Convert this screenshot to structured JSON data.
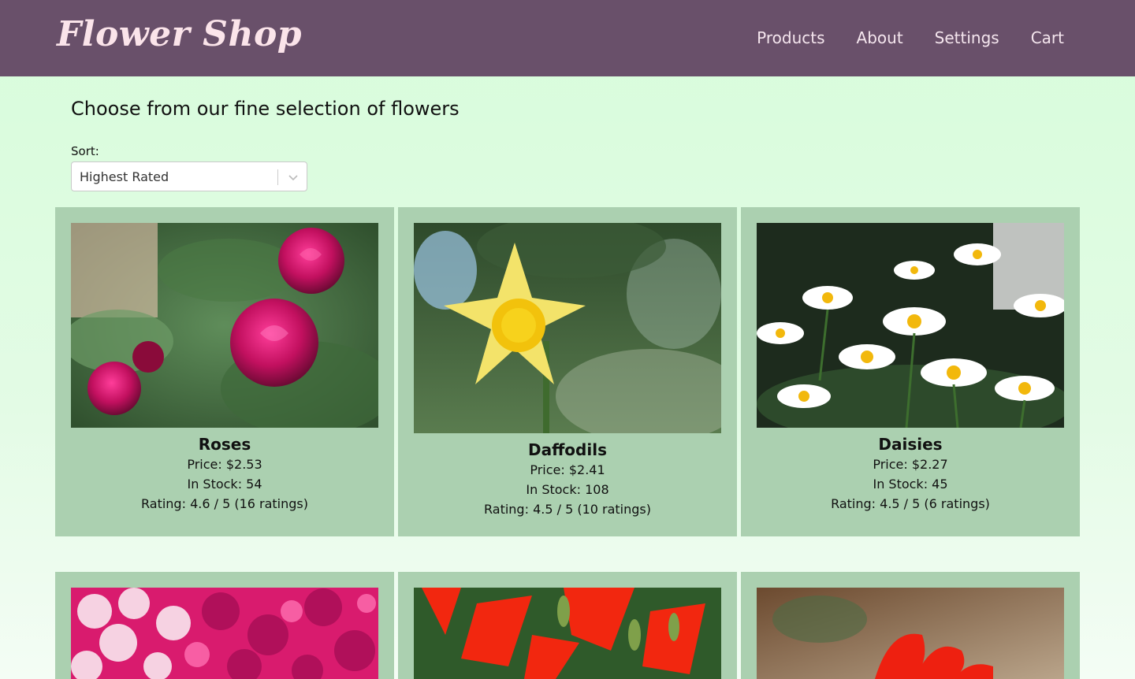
{
  "brand": "Flower Shop",
  "nav": [
    "Products",
    "About",
    "Settings",
    "Cart"
  ],
  "headline": "Choose from our fine selection of flowers",
  "sort": {
    "label": "Sort:",
    "selected": "Highest Rated"
  },
  "products": [
    {
      "name": "Roses",
      "price": "Price: $2.53",
      "stock": "In Stock: 54",
      "rating": "Rating: 4.6 / 5 (16 ratings)"
    },
    {
      "name": "Daffodils",
      "price": "Price: $2.41",
      "stock": "In Stock: 108",
      "rating": "Rating: 4.5 / 5 (10 ratings)"
    },
    {
      "name": "Daisies",
      "price": "Price: $2.27",
      "stock": "In Stock: 45",
      "rating": "Rating: 4.5 / 5 (6 ratings)"
    }
  ],
  "image_names": [
    "roses-photo",
    "daffodils-photo",
    "daisies-photo",
    "carnations-photo",
    "lilies-photo",
    "tulips-photo"
  ]
}
